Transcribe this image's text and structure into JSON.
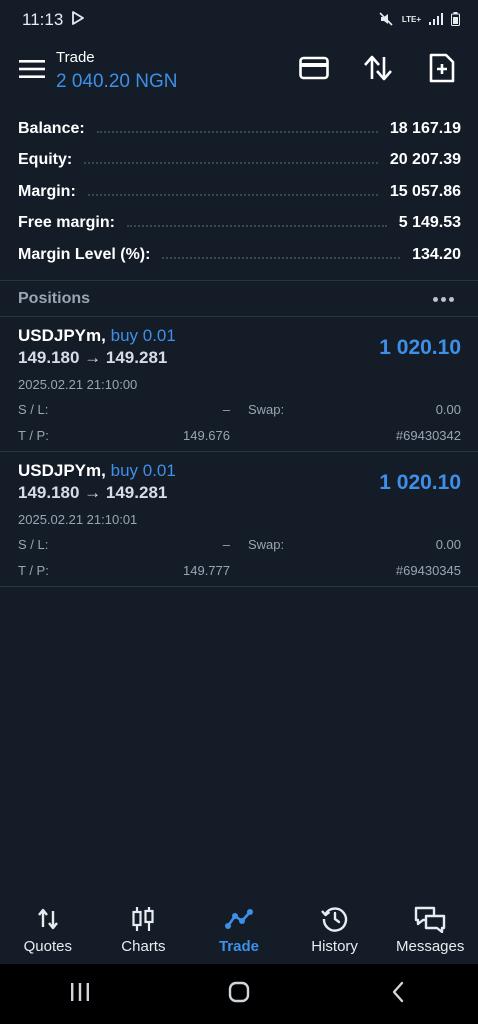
{
  "status": {
    "time": "11:13",
    "network": "LTE+"
  },
  "header": {
    "title": "Trade",
    "subtitle": "2 040.20 NGN"
  },
  "summary": [
    {
      "label": "Balance:",
      "value": "18 167.19"
    },
    {
      "label": "Equity:",
      "value": "20 207.39"
    },
    {
      "label": "Margin:",
      "value": "15 057.86"
    },
    {
      "label": "Free margin:",
      "value": "5 149.53"
    },
    {
      "label": "Margin Level (%):",
      "value": "134.20"
    }
  ],
  "positions_title": "Positions",
  "positions": [
    {
      "symbol": "USDJPYm,",
      "type": "buy 0.01",
      "prices": "149.180 → 149.281",
      "profit": "1 020.10",
      "time": "2025.02.21 21:10:00",
      "sl_label": "S / L:",
      "sl_value": "–",
      "swap_label": "Swap:",
      "swap_value": "0.00",
      "tp_label": "T / P:",
      "tp_value": "149.676",
      "ticket": "#69430342"
    },
    {
      "symbol": "USDJPYm,",
      "type": "buy 0.01",
      "prices": "149.180 → 149.281",
      "profit": "1 020.10",
      "time": "2025.02.21 21:10:01",
      "sl_label": "S / L:",
      "sl_value": "–",
      "swap_label": "Swap:",
      "swap_value": "0.00",
      "tp_label": "T / P:",
      "tp_value": "149.777",
      "ticket": "#69430345"
    }
  ],
  "nav": [
    {
      "label": "Quotes",
      "icon": "quotes-icon"
    },
    {
      "label": "Charts",
      "icon": "charts-icon"
    },
    {
      "label": "Trade",
      "icon": "trade-icon",
      "active": true
    },
    {
      "label": "History",
      "icon": "history-icon"
    },
    {
      "label": "Messages",
      "icon": "messages-icon"
    }
  ],
  "colors": {
    "background": "#141c27",
    "accent": "#3e8fe8",
    "muted": "#9aa5b3"
  }
}
